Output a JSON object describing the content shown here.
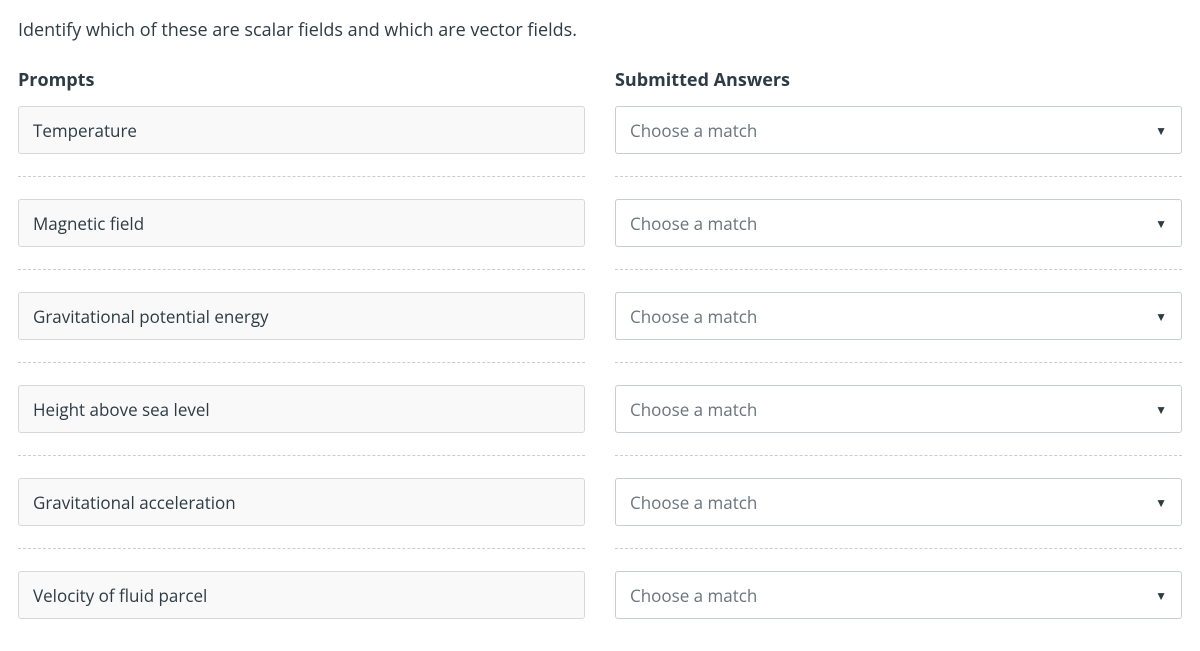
{
  "question": "Identify which of these are scalar fields and which are vector fields.",
  "headers": {
    "prompts": "Prompts",
    "answers": "Submitted Answers"
  },
  "rows": [
    {
      "prompt": "Temperature",
      "answer": "Choose a match"
    },
    {
      "prompt": "Magnetic field",
      "answer": "Choose a match"
    },
    {
      "prompt": "Gravitational potential energy",
      "answer": "Choose a match"
    },
    {
      "prompt": "Height above sea level",
      "answer": "Choose a match"
    },
    {
      "prompt": "Gravitational acceleration",
      "answer": "Choose a match"
    },
    {
      "prompt": "Velocity of fluid parcel",
      "answer": "Choose a match"
    }
  ]
}
